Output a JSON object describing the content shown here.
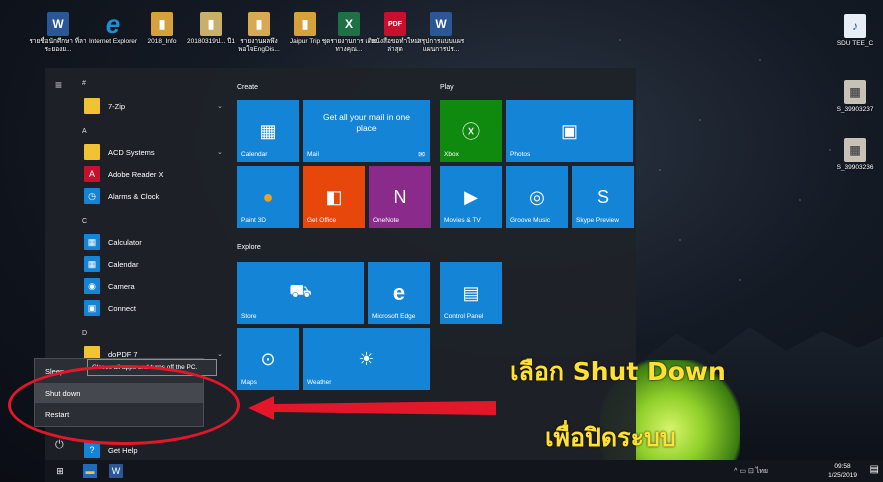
{
  "desktop": {
    "icons": [
      {
        "label": "รายชื่อนักศึกษา ที่ลาระยองย...",
        "glyph": "W",
        "color": "#2b5797"
      },
      {
        "label": "Internet Explorer",
        "glyph": "e",
        "color": "#1c8fd6"
      },
      {
        "label": "2018_Info",
        "glyph": "▮",
        "color": "#d6a13a"
      },
      {
        "label": "20180319ป... ปี1",
        "glyph": "▮",
        "color": "#c9b06a"
      },
      {
        "label": "รายงานผลพึง พอใจEngDis...",
        "glyph": "▮",
        "color": "#d8a852"
      },
      {
        "label": "Jaipur Trip",
        "glyph": "▮",
        "color": "#d6a13a"
      },
      {
        "label": "ชุดรายงานการ เดินทางคุณ...",
        "glyph": "X",
        "color": "#1e7145"
      },
      {
        "label": "หนังสือขอทำใหม่ ล่าสุด",
        "glyph": "PDF",
        "color": "#c8102e"
      },
      {
        "label": "สรุปการแบบแผร แผนการปร...",
        "glyph": "W",
        "color": "#2b5797"
      }
    ],
    "right_icons": [
      {
        "label": "SDU TEE_C",
        "glyph": "♪"
      },
      {
        "label": "S_39903237",
        "glyph": "▦"
      },
      {
        "label": "S_39903236",
        "glyph": "▦"
      }
    ]
  },
  "start_menu": {
    "hamburger_icon": "≡",
    "power_icon": "⏻",
    "apps": [
      {
        "kind": "letter",
        "text": "#"
      },
      {
        "kind": "app",
        "name": "7-Zip",
        "glyph": "▮",
        "color": "#f1c232",
        "chev": "⌄"
      },
      {
        "kind": "letter",
        "text": "A"
      },
      {
        "kind": "app",
        "name": "ACD Systems",
        "glyph": "▮",
        "color": "#f1c232",
        "chev": "⌄"
      },
      {
        "kind": "app",
        "name": "Adobe Reader X",
        "glyph": "A",
        "color": "#c8102e",
        "chev": ""
      },
      {
        "kind": "app",
        "name": "Alarms & Clock",
        "glyph": "◷",
        "color": "#1484d6",
        "chev": ""
      },
      {
        "kind": "letter",
        "text": "C"
      },
      {
        "kind": "app",
        "name": "Calculator",
        "glyph": "▦",
        "color": "#1484d6",
        "chev": ""
      },
      {
        "kind": "app",
        "name": "Calendar",
        "glyph": "▦",
        "color": "#1484d6",
        "chev": ""
      },
      {
        "kind": "app",
        "name": "Camera",
        "glyph": "◉",
        "color": "#1484d6",
        "chev": ""
      },
      {
        "kind": "app",
        "name": "Connect",
        "glyph": "▣",
        "color": "#1484d6",
        "chev": ""
      },
      {
        "kind": "letter",
        "text": "D"
      },
      {
        "kind": "app",
        "name": "doPDF 7",
        "glyph": "▮",
        "color": "#f1c232",
        "chev": "⌄"
      },
      {
        "kind": "app",
        "name": "Get Help",
        "glyph": "?",
        "color": "#1484d6",
        "chev": ""
      }
    ],
    "sections": {
      "create": "Create",
      "play": "Play",
      "explore": "Explore"
    },
    "tiles": {
      "calendar": {
        "label": "Calendar",
        "glyph": "▦"
      },
      "mail": {
        "label": "Mail",
        "title": "Get all your mail in one place",
        "glyph": "✉"
      },
      "xbox": {
        "label": "Xbox",
        "glyph": "ⓧ"
      },
      "photos": {
        "label": "Photos",
        "glyph": "▣"
      },
      "paint3d": {
        "label": "Paint 3D",
        "glyph": "●"
      },
      "getoffice": {
        "label": "Get Office",
        "glyph": "◧"
      },
      "onenote": {
        "label": "OneNote",
        "glyph": "N"
      },
      "movies": {
        "label": "Movies & TV",
        "glyph": "▶"
      },
      "groove": {
        "label": "Groove Music",
        "glyph": "◎"
      },
      "skype": {
        "label": "Skype Preview",
        "glyph": "S"
      },
      "store": {
        "label": "Store",
        "glyph": "⛟"
      },
      "edge": {
        "label": "Microsoft Edge",
        "glyph": "e"
      },
      "controlpanel": {
        "label": "Control Panel",
        "glyph": "▤"
      },
      "maps": {
        "label": "Maps",
        "glyph": "⊙"
      },
      "weather": {
        "label": "Weather",
        "glyph": "☀"
      }
    }
  },
  "power_menu": {
    "items": [
      "Sleep",
      "Shut down",
      "Restart"
    ],
    "tooltip": "Closes all apps and turns off the PC."
  },
  "annotation": {
    "line1": "เลือก Shut Down",
    "line2": "เพื่อปิดระบบ",
    "color": "#ffe033",
    "ring_color": "#e3172a"
  },
  "taskbar": {
    "start_icon": "⊞",
    "explorer_icon": "▬",
    "word_icon": "W",
    "tray": "^ ▭ ⊡ ไทย",
    "time": "09:58",
    "date": "1/25/2019",
    "notification_icon": "▤"
  }
}
